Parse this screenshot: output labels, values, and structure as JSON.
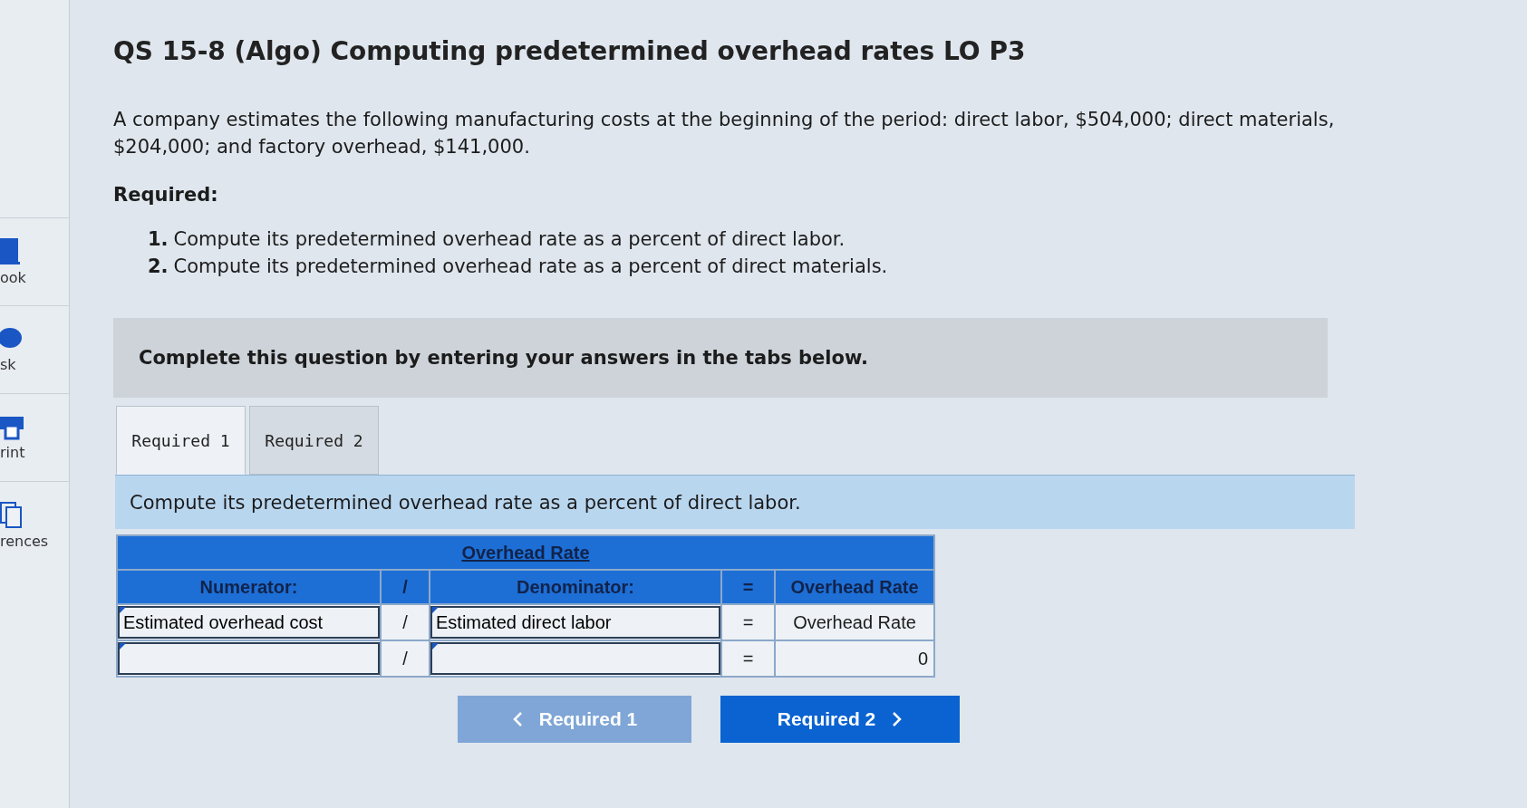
{
  "sidebar": {
    "items": [
      {
        "kind": "book",
        "label": "ook"
      },
      {
        "kind": "chat",
        "label": "sk"
      },
      {
        "kind": "print",
        "label": "rint"
      },
      {
        "kind": "copy",
        "label": "rences"
      }
    ]
  },
  "title": "QS 15-8 (Algo) Computing predetermined overhead rates LO P3",
  "problem": "A company estimates the following manufacturing costs at the beginning of the period: direct labor, $504,000; direct materials, $204,000; and factory overhead, $141,000.",
  "required_heading": "Required:",
  "requirements": [
    {
      "number": "1.",
      "text": "Compute its predetermined overhead rate as a percent of direct labor."
    },
    {
      "number": "2.",
      "text": "Compute its predetermined overhead rate as a percent of direct materials."
    }
  ],
  "instruction": "Complete this question by entering your answers in the tabs below.",
  "tabs": [
    {
      "label": "Required 1",
      "selected": true
    },
    {
      "label": "Required 2",
      "selected": false
    }
  ],
  "tab_prompt": "Compute its predetermined overhead rate as a percent of direct labor.",
  "table": {
    "title": "Overhead Rate",
    "headers": [
      "Numerator:",
      "/",
      "Denominator:",
      "=",
      "Overhead Rate"
    ],
    "rows": [
      {
        "numerator": "Estimated overhead cost",
        "slash": "/",
        "denominator": "Estimated direct labor",
        "equals": "=",
        "result": "Overhead Rate",
        "kind": "label"
      },
      {
        "slash": "/",
        "equals": "=",
        "result": "0",
        "kind": "number"
      }
    ]
  },
  "buttons": [
    {
      "label": "Required 1",
      "kind": "prev",
      "disabled": true
    },
    {
      "label": "Required 2",
      "kind": "next",
      "disabled": false
    }
  ]
}
